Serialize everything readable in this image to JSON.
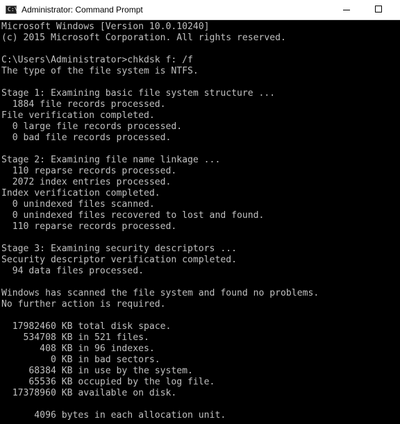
{
  "window": {
    "title": "Administrator: Command Prompt",
    "icon_glyph": "C:\\",
    "icon": "cmd-icon",
    "controls": [
      "minimize-icon",
      "maximize-icon"
    ]
  },
  "colors": {
    "console_background": "#000000",
    "console_text": "#c0c0c0",
    "titlebar_background": "#ffffff"
  },
  "console": {
    "lines": [
      "Microsoft Windows [Version 10.0.10240]",
      "(c) 2015 Microsoft Corporation. All rights reserved.",
      "",
      "C:\\Users\\Administrator>chkdsk f: /f",
      "The type of the file system is NTFS.",
      "",
      "Stage 1: Examining basic file system structure ...",
      "  1884 file records processed.",
      "File verification completed.",
      "  0 large file records processed.",
      "  0 bad file records processed.",
      "",
      "Stage 2: Examining file name linkage ...",
      "  110 reparse records processed.",
      "  2072 index entries processed.",
      "Index verification completed.",
      "  0 unindexed files scanned.",
      "  0 unindexed files recovered to lost and found.",
      "  110 reparse records processed.",
      "",
      "Stage 3: Examining security descriptors ...",
      "Security descriptor verification completed.",
      "  94 data files processed.",
      "",
      "Windows has scanned the file system and found no problems.",
      "No further action is required.",
      "",
      "  17982460 KB total disk space.",
      "    534708 KB in 521 files.",
      "       408 KB in 96 indexes.",
      "         0 KB in bad sectors.",
      "     68384 KB in use by the system.",
      "     65536 KB occupied by the log file.",
      "  17378960 KB available on disk.",
      "",
      "      4096 bytes in each allocation unit."
    ]
  }
}
